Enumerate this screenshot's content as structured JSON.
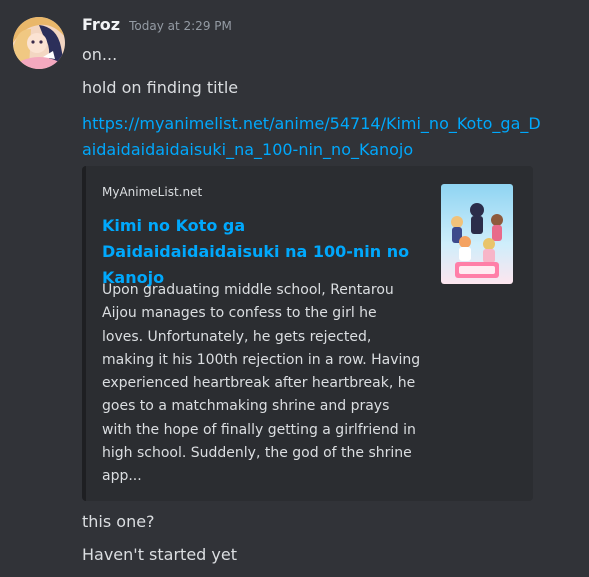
{
  "message": {
    "author": "Froz",
    "timestamp": "Today at 2:29 PM",
    "avatar_icon": "anime-girl-avatar",
    "lines": [
      "on...",
      "hold on finding title"
    ],
    "link": "https://myanimelist.net/anime/54714/Kimi_no_Koto_ga_Daidaidaidaidaisuki_na_100-nin_no_Kanojo"
  },
  "embed": {
    "provider": "MyAnimeList.net",
    "title": "Kimi no Koto ga Daidaidaidaidaisuki na 100-nin no Kanojo",
    "description": "Upon graduating middle school, Rentarou Aijou manages to confess to the girl he loves. Unfortunately, he gets rejected, making it his 100th rejection in a row. Having experienced heartbreak after heartbreak, he goes to a matchmaking shrine and prays with the hope of finally getting a girlfriend in high school. Suddenly, the god of the shrine app...",
    "thumbnail_icon": "anime-cover-thumbnail"
  },
  "followups": [
    "this one?",
    "Haven't started yet"
  ],
  "colors": {
    "background": "#313338",
    "embed_background": "#2b2d31",
    "link": "#00a8fc",
    "text": "#dbdee1",
    "muted": "#949ba4"
  }
}
